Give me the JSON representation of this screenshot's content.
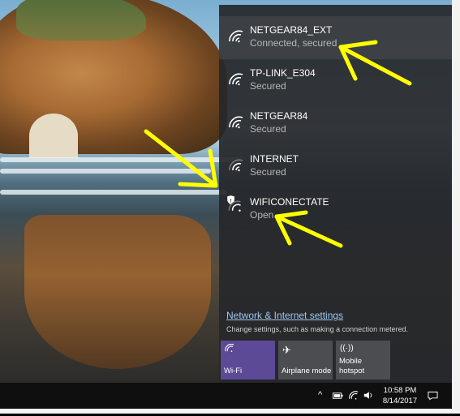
{
  "networks": [
    {
      "name": "NETGEAR84_EXT",
      "status": "Connected, secured",
      "icon": "wifi-icon",
      "secure_warning": false
    },
    {
      "name": "TP-LINK_E304",
      "status": "Secured",
      "icon": "wifi-icon",
      "secure_warning": false
    },
    {
      "name": "NETGEAR84",
      "status": "Secured",
      "icon": "wifi-icon",
      "secure_warning": false
    },
    {
      "name": "INTERNET",
      "status": "Secured",
      "icon": "wifi-icon",
      "secure_warning": false
    },
    {
      "name": "WIFICONECTATE",
      "status": "Open",
      "icon": "wifi-open-warning-icon",
      "secure_warning": true
    }
  ],
  "settings": {
    "link": "Network & Internet settings",
    "description": "Change settings, such as making a connection metered."
  },
  "tiles": [
    {
      "label": "Wi-Fi",
      "icon": "wifi-icon",
      "active": true
    },
    {
      "label": "Airplane mode",
      "icon": "airplane-icon",
      "active": false
    },
    {
      "label": "Mobile hotspot",
      "label_line1": "Mobile",
      "label_line2": "hotspot",
      "icon": "hotspot-icon",
      "active": false
    }
  ],
  "taskbar": {
    "time": "10:58 PM",
    "date": "8/14/2017",
    "tray_icons": [
      "chevron-up-icon",
      "battery-icon",
      "wifi-icon",
      "volume-icon",
      "action-center-icon"
    ]
  },
  "colors": {
    "flyout_bg": "#26282b",
    "accent": "#5d4a96",
    "link": "#9ec7f2",
    "annotation": "#ffff00"
  }
}
